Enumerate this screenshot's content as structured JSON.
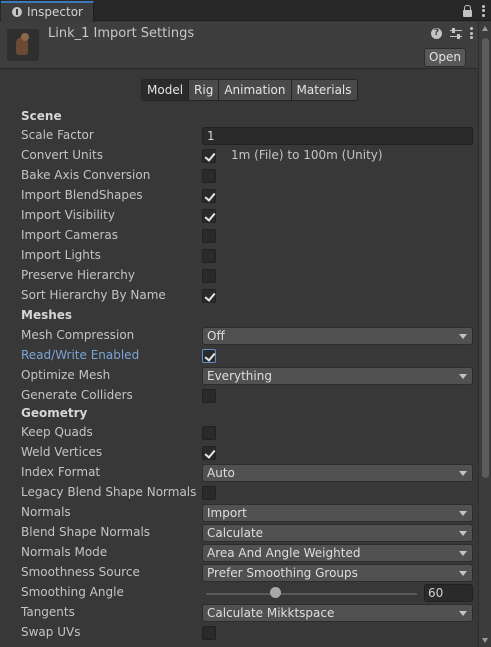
{
  "window": {
    "tab_title": "Inspector"
  },
  "header": {
    "title": "Link_1 Import Settings",
    "open_label": "Open"
  },
  "subtabs": [
    "Model",
    "Rig",
    "Animation",
    "Materials"
  ],
  "scene": {
    "title": "Scene",
    "scale_factor_label": "Scale Factor",
    "scale_factor_value": "1",
    "convert_units_label": "Convert Units",
    "convert_units_note": "1m (File) to 100m (Unity)",
    "bake_axis_label": "Bake Axis Conversion",
    "import_blendshapes_label": "Import BlendShapes",
    "import_visibility_label": "Import Visibility",
    "import_cameras_label": "Import Cameras",
    "import_lights_label": "Import Lights",
    "preserve_hierarchy_label": "Preserve Hierarchy",
    "sort_hierarchy_label": "Sort Hierarchy By Name"
  },
  "meshes": {
    "title": "Meshes",
    "mesh_compression_label": "Mesh Compression",
    "mesh_compression_value": "Off",
    "read_write_label": "Read/Write Enabled",
    "optimize_mesh_label": "Optimize Mesh",
    "optimize_mesh_value": "Everything",
    "generate_colliders_label": "Generate Colliders"
  },
  "geometry": {
    "title": "Geometry",
    "keep_quads_label": "Keep Quads",
    "weld_vertices_label": "Weld Vertices",
    "index_format_label": "Index Format",
    "index_format_value": "Auto",
    "legacy_blend_label": "Legacy Blend Shape Normals",
    "normals_label": "Normals",
    "normals_value": "Import",
    "blend_shape_normals_label": "Blend Shape Normals",
    "blend_shape_normals_value": "Calculate",
    "normals_mode_label": "Normals Mode",
    "normals_mode_value": "Area And Angle Weighted",
    "smoothness_source_label": "Smoothness Source",
    "smoothness_source_value": "Prefer Smoothing Groups",
    "smoothing_angle_label": "Smoothing Angle",
    "smoothing_angle_value": "60",
    "tangents_label": "Tangents",
    "tangents_value": "Calculate Mikktspace",
    "swap_uvs_label": "Swap UVs"
  },
  "colors": {
    "accent": "#3a79bb",
    "link_label": "#7ba4d6"
  }
}
